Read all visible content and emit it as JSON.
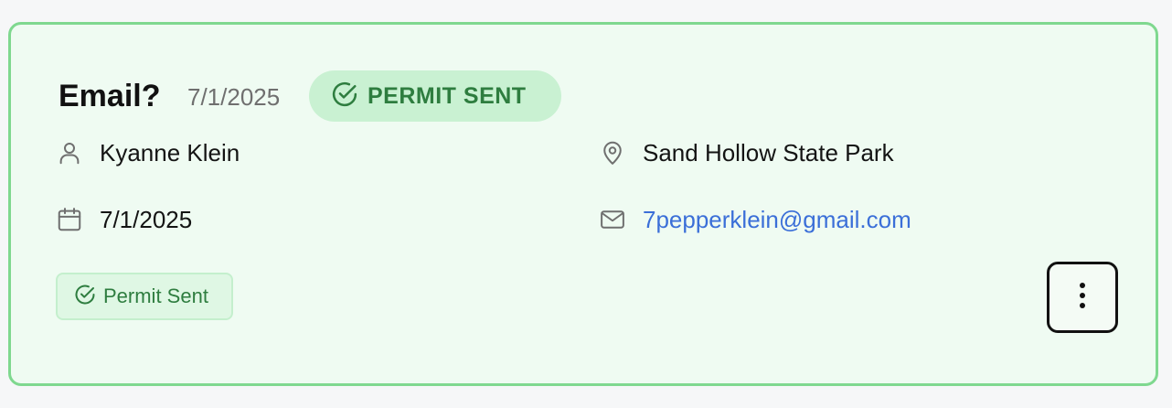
{
  "card": {
    "title": "Email?",
    "date": "7/1/2025",
    "status_label": "PERMIT SENT",
    "status_icon": "check-circle-icon",
    "name": "Kyanne Klein",
    "name_icon": "user-icon",
    "location": "Sand Hollow State Park",
    "location_icon": "map-pin-icon",
    "event_date": "7/1/2025",
    "event_date_icon": "calendar-icon",
    "email": "7pepperklein@gmail.com",
    "email_icon": "mail-icon",
    "badge_label": "Permit Sent",
    "badge_icon": "check-circle-icon",
    "menu_icon": "more-vertical-icon"
  },
  "colors": {
    "card_border": "#7fd88f",
    "card_background": "#effbf2",
    "status_pill_bg": "#c9f1d2",
    "status_text": "#2e7d3f",
    "link": "#3b6fd8"
  }
}
